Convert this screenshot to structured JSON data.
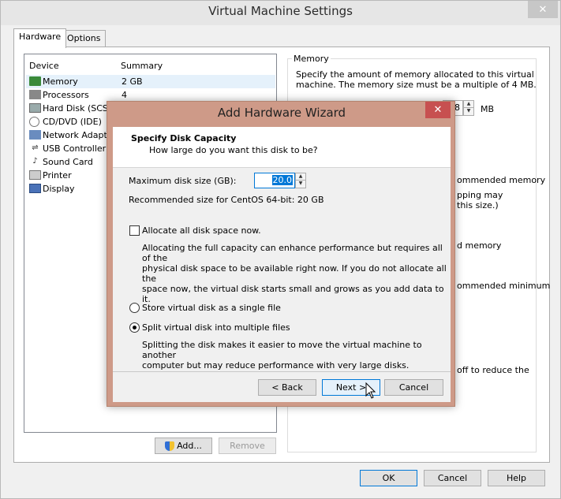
{
  "window": {
    "title": "Virtual Machine Settings",
    "close_glyph": "✕"
  },
  "tabs": [
    {
      "label": "Hardware",
      "active": true
    },
    {
      "label": "Options",
      "active": false
    }
  ],
  "device_list": {
    "headers": {
      "device": "Device",
      "summary": "Summary"
    },
    "items": [
      {
        "name": "Memory",
        "summary": "2 GB",
        "icon": "memory-icon",
        "selected": true
      },
      {
        "name": "Processors",
        "summary": "4",
        "icon": "processor-icon"
      },
      {
        "name": "Hard Disk (SCSI)",
        "summary": "",
        "icon": "hard-disk-icon"
      },
      {
        "name": "CD/DVD (IDE)",
        "summary": "",
        "icon": "cd-dvd-icon"
      },
      {
        "name": "Network Adapter",
        "summary": "",
        "icon": "network-adapter-icon"
      },
      {
        "name": "USB Controller",
        "summary": "",
        "icon": "usb-icon"
      },
      {
        "name": "Sound Card",
        "summary": "",
        "icon": "sound-card-icon"
      },
      {
        "name": "Printer",
        "summary": "",
        "icon": "printer-icon"
      },
      {
        "name": "Display",
        "summary": "",
        "icon": "display-icon"
      }
    ],
    "add_label": "Add...",
    "remove_label": "Remove"
  },
  "memory_panel": {
    "legend": "Memory",
    "description_line1": "Specify the amount of memory allocated to this virtual",
    "description_line2": "machine. The memory size must be a multiple of 4 MB.",
    "value_visible": "8",
    "unit": "MB",
    "partial_texts": [
      "ommended memory",
      "pping may",
      " this size.)",
      "d memory",
      "ommended minimum",
      " off to reduce the"
    ]
  },
  "footer": {
    "ok": "OK",
    "cancel": "Cancel",
    "help": "Help"
  },
  "wizard": {
    "title": "Add Hardware Wizard",
    "close_glyph": "✕",
    "heading": "Specify Disk Capacity",
    "subheading": "How large do you want this disk to be?",
    "max_size_label": "Maximum disk size (GB):",
    "max_size_value": "20.0",
    "recommended": "Recommended size for CentOS 64-bit: 20 GB",
    "allocate_label": "Allocate all disk space now.",
    "allocate_checked": false,
    "allocate_desc_1": "Allocating the full capacity can enhance performance but requires all of the",
    "allocate_desc_2": "physical disk space to be available right now. If you do not allocate all the",
    "allocate_desc_3": "space now, the virtual disk starts small and grows as you add data to it.",
    "single_file_label": "Store virtual disk as a single file",
    "split_label": "Split virtual disk into multiple files",
    "split_desc_1": "Splitting the disk makes it easier to move the virtual machine to another",
    "split_desc_2": "computer but may reduce performance with very large disks.",
    "back": "< Back",
    "next": "Next >",
    "cancel": "Cancel"
  },
  "colors": {
    "accent": "#0078d7",
    "wizard_frame": "#ce9a88",
    "wizard_close": "#c75050",
    "selection": "#e5f1fb"
  }
}
